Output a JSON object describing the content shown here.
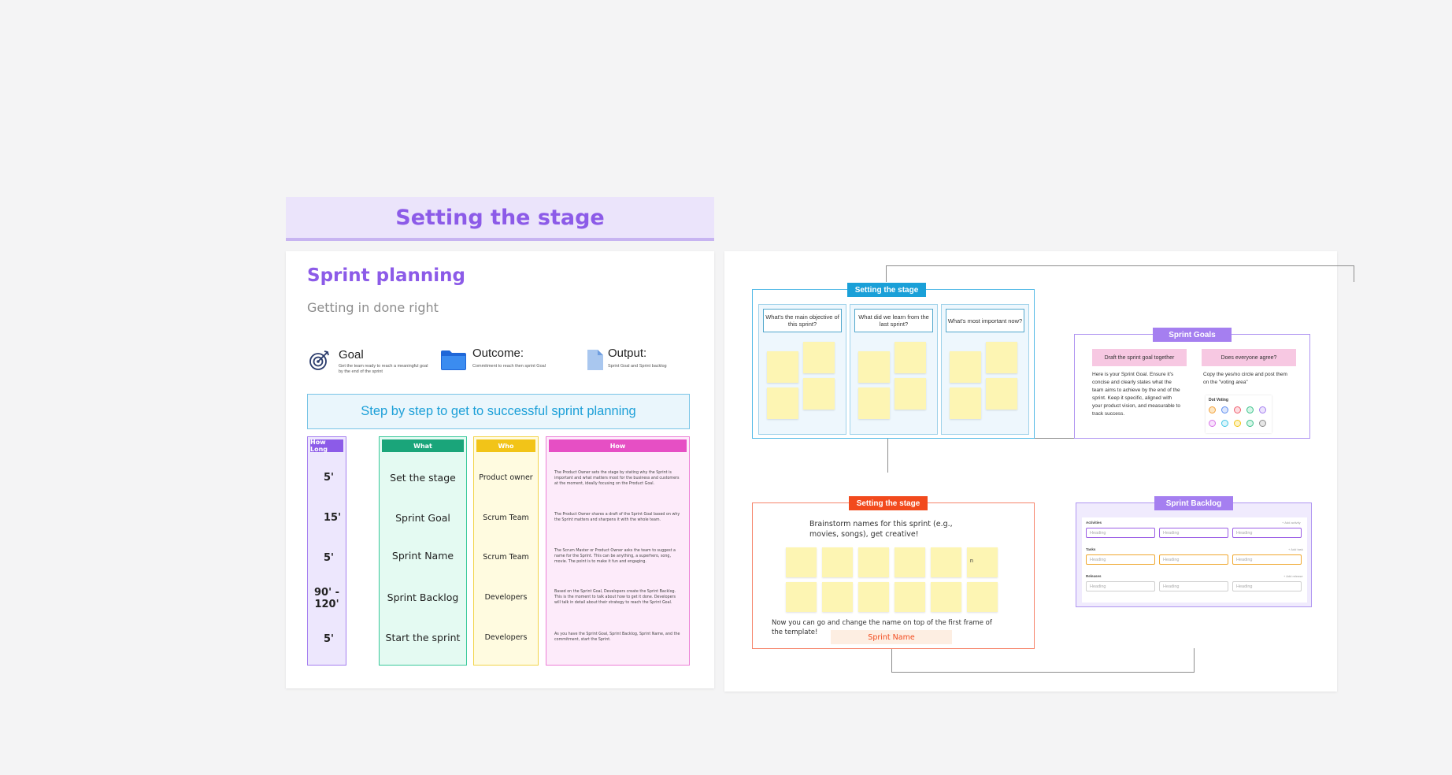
{
  "banner": {
    "title": "Setting the stage"
  },
  "left": {
    "title": "Sprint planning",
    "subtitle": "Getting in done right",
    "info": [
      {
        "label": "Goal",
        "desc": "Get the team ready to reach a meaningful goal by the end of the sprint",
        "icon": "target-icon"
      },
      {
        "label": "Outcome:",
        "desc": "Commitment to reach then sprint Goal",
        "icon": "folder-icon"
      },
      {
        "label": "Output:",
        "desc": "Sprint Goal and Sprint backlog",
        "icon": "document-icon"
      }
    ],
    "step_title": "Step by step to get to successful sprint planning",
    "columns": {
      "how_long": {
        "header": "How Long",
        "items": [
          "5'",
          "15'",
          "5'",
          "90' - 120'",
          "5'"
        ]
      },
      "what": {
        "header": "What",
        "items": [
          "Set the stage",
          "Sprint Goal",
          "Sprint Name",
          "Sprint Backlog",
          "Start the sprint"
        ]
      },
      "who": {
        "header": "Who",
        "items": [
          "Product owner",
          "Scrum Team",
          "Scrum Team",
          "Developers",
          "Developers"
        ]
      },
      "how": {
        "header": "How",
        "items": [
          "The Product Owner sets the stage by stating why the Sprint is important and what matters most for the business and customers at the moment, ideally focusing on the Product Goal.",
          "The Product Owner shares a draft of the Sprint Goal based on why the Sprint matters and sharpens it with the whole team.",
          "The Scrum Master or Product Owner asks the team to suggest a name for the Sprint. This can be anything, a superhero, song, movie. The point is to make it fun and engaging.",
          "Based on the Sprint Goal, Developers create the Sprint Backlog. This is the moment to talk about how to get it done. Developers will talk in detail about their strategy to reach the Sprint Goal.",
          "As you have the Sprint Goal, Sprint Backlog, Sprint Name, and the commitment, start the Sprint."
        ]
      }
    }
  },
  "right": {
    "frame1": {
      "tag": "Setting the stage",
      "questions": [
        "What's the main objective of this sprint?",
        "What did we learn from the last sprint?",
        "What's most important now?"
      ]
    },
    "goals": {
      "tag": "Sprint Goals",
      "bar1": "Draft the sprint goal together",
      "bar2": "Does everyone agree?",
      "text1": "Here is your Sprint Goal. Ensure it's concise and clearly states what the team aims to achieve by the end of the sprint. Keep it specific, aligned with your product vision, and measurable to track success.",
      "text2": "Copy the yes/no circle and post them on the \"voting area\"",
      "dot_title": "Dot Voting"
    },
    "frame3": {
      "tag": "Setting the stage",
      "prompt": "Brainstorm names for this sprint (e.g., movies, songs), get creative!",
      "sticky_text": "n",
      "note": "Now you can go and change the name on top of the first frame of the template!",
      "name_label": "Sprint Name"
    },
    "backlog": {
      "tag": "Sprint Backlog",
      "rows": [
        {
          "label": "Activities",
          "add": "+ Add activity",
          "color": "#9b5de5"
        },
        {
          "label": "Tasks",
          "add": "+ Add task",
          "color": "#f0a830"
        },
        {
          "label": "Releases",
          "add": "+ Add release",
          "color": "#cfcfcf"
        }
      ],
      "heading": "Heading"
    }
  },
  "colors": {
    "purple": "#8c5be8",
    "green": "#1aa57a",
    "yellow": "#f2c418",
    "pink": "#e64fc4",
    "blue": "#1aa0d8",
    "orange_red": "#f24a1d",
    "violet": "#a57ff0"
  }
}
